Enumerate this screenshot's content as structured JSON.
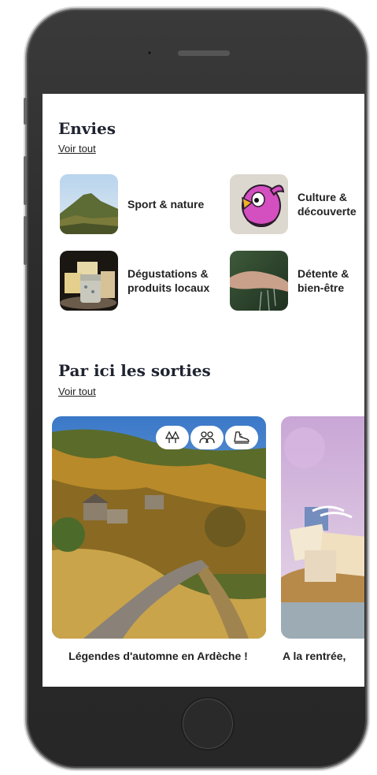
{
  "envies": {
    "title": "Envies",
    "voir_tout": "Voir tout",
    "categories": [
      {
        "label": "Sport & nature",
        "icon": "volcano-landscape"
      },
      {
        "label": "Culture & découverte",
        "icon": "pink-bird-mascot"
      },
      {
        "label": "Dégustations & produits locaux",
        "icon": "cheese-plate"
      },
      {
        "label": "Détente & bien-être",
        "icon": "hands-water"
      }
    ]
  },
  "sorties": {
    "title": "Par ici les sorties",
    "voir_tout": "Voir tout",
    "cards": [
      {
        "title": "Légendes d'automne en Ardèche !",
        "icons": [
          "trees-icon",
          "group-icon",
          "hiking-shoe-icon"
        ]
      },
      {
        "title": "A la rentrée,"
      }
    ]
  },
  "colors": {
    "phone_frame": "#2a2a2a",
    "title_text": "#1f2330"
  }
}
